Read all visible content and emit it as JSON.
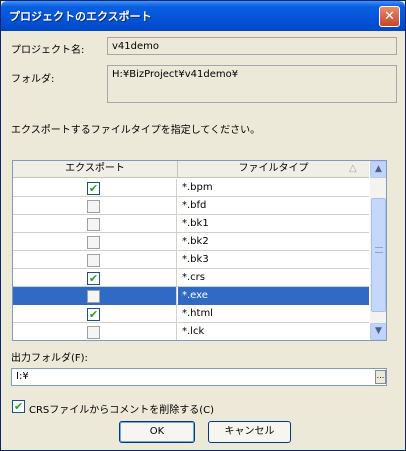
{
  "window": {
    "title": "プロジェクトのエクスポート",
    "close_glyph": "✕"
  },
  "project": {
    "label": "プロジェクト名:",
    "value": "v41demo"
  },
  "folder": {
    "label": "フォルダ:",
    "value": "H:¥BizProject¥v41demo¥"
  },
  "instruction": "エクスポートするファイルタイプを指定してください。",
  "table": {
    "headers": {
      "export": "エクスポート",
      "filetype": "ファイルタイプ"
    },
    "sort_glyph": "△",
    "rows": [
      {
        "checked": true,
        "type": "*.bpm"
      },
      {
        "checked": false,
        "type": "*.bfd"
      },
      {
        "checked": false,
        "type": "*.bk1"
      },
      {
        "checked": false,
        "type": "*.bk2"
      },
      {
        "checked": false,
        "type": "*.bk3"
      },
      {
        "checked": true,
        "type": "*.crs"
      },
      {
        "checked": false,
        "type": "*.exe",
        "selected": true
      },
      {
        "checked": true,
        "type": "*.html"
      },
      {
        "checked": false,
        "type": "*.lck"
      },
      {
        "checked": true,
        "type": "*..."
      }
    ]
  },
  "scrollbar": {
    "up_glyph": "▲",
    "down_glyph": "▼"
  },
  "output": {
    "label": "出力フォルダ(F):",
    "value": "I:¥",
    "browse_glyph": "..."
  },
  "crs_option": {
    "checked": true,
    "label": "CRSファイルからコメントを削除する(C)",
    "check_glyph": "✔"
  },
  "buttons": {
    "ok": "OK",
    "cancel": "キャンセル"
  },
  "colors": {
    "titlebar": "#0554d8",
    "selection": "#316ac5",
    "face": "#ece9d8"
  }
}
